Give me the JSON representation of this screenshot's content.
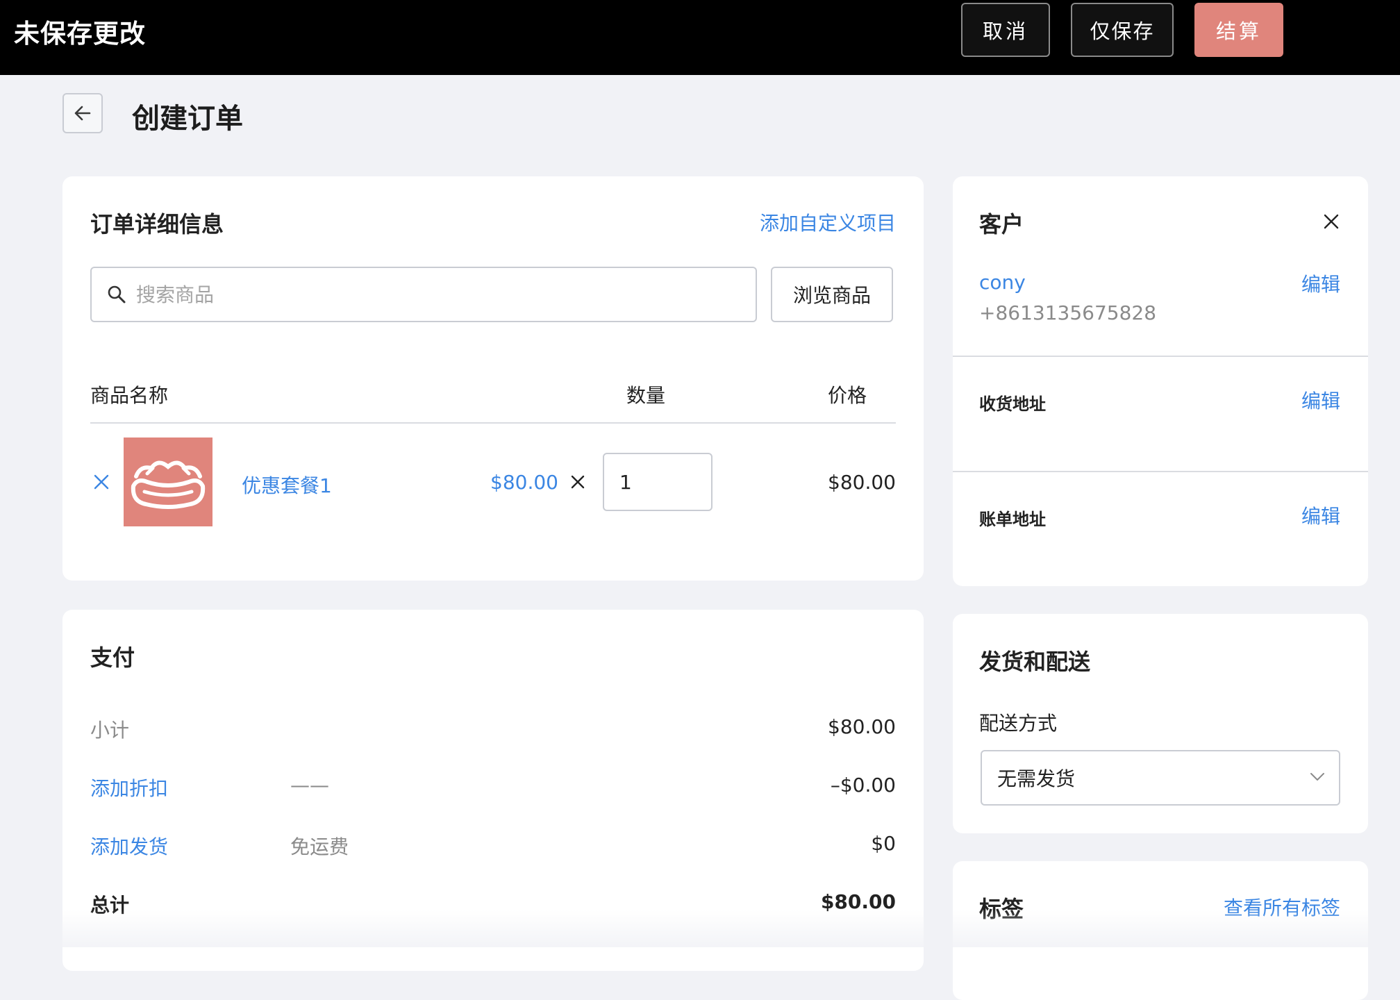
{
  "topbar": {
    "title": "未保存更改",
    "cancel_label": "取消",
    "save_only_label": "仅保存",
    "checkout_label": "结算",
    "checkout_color": "#e0857c"
  },
  "header": {
    "back_icon": "arrow-left-icon",
    "title": "创建订单"
  },
  "order_details": {
    "title": "订单详细信息",
    "add_custom_item": "添加自定义项目",
    "search_placeholder": "搜索商品",
    "browse_label": "浏览商品",
    "columns": {
      "name": "商品名称",
      "quantity": "数量",
      "price": "价格"
    },
    "items": [
      {
        "name": "优惠套餐1",
        "unit_price": "$80.00",
        "quantity": "1",
        "total": "$80.00",
        "thumb_color": "#e0857c"
      }
    ]
  },
  "payment": {
    "title": "支付",
    "subtotal_label": "小计",
    "subtotal_value": "$80.00",
    "discount_label": "添加折扣",
    "discount_desc": "——",
    "discount_value": "–$0.00",
    "shipping_label": "添加发货",
    "shipping_desc": "免运费",
    "shipping_value": "$0",
    "total_label": "总计",
    "total_value": "$80.00"
  },
  "customer": {
    "title": "客户",
    "name": "cony",
    "phone": "+8613135675828",
    "edit_label": "编辑",
    "shipping_address_label": "收货地址",
    "billing_address_label": "账单地址"
  },
  "shipping": {
    "title": "发货和配送",
    "method_label": "配送方式",
    "method_value": "无需发货"
  },
  "tags": {
    "title": "标签",
    "view_all": "查看所有标签"
  },
  "colors": {
    "link": "#3b86e3",
    "accent": "#e0857c"
  }
}
